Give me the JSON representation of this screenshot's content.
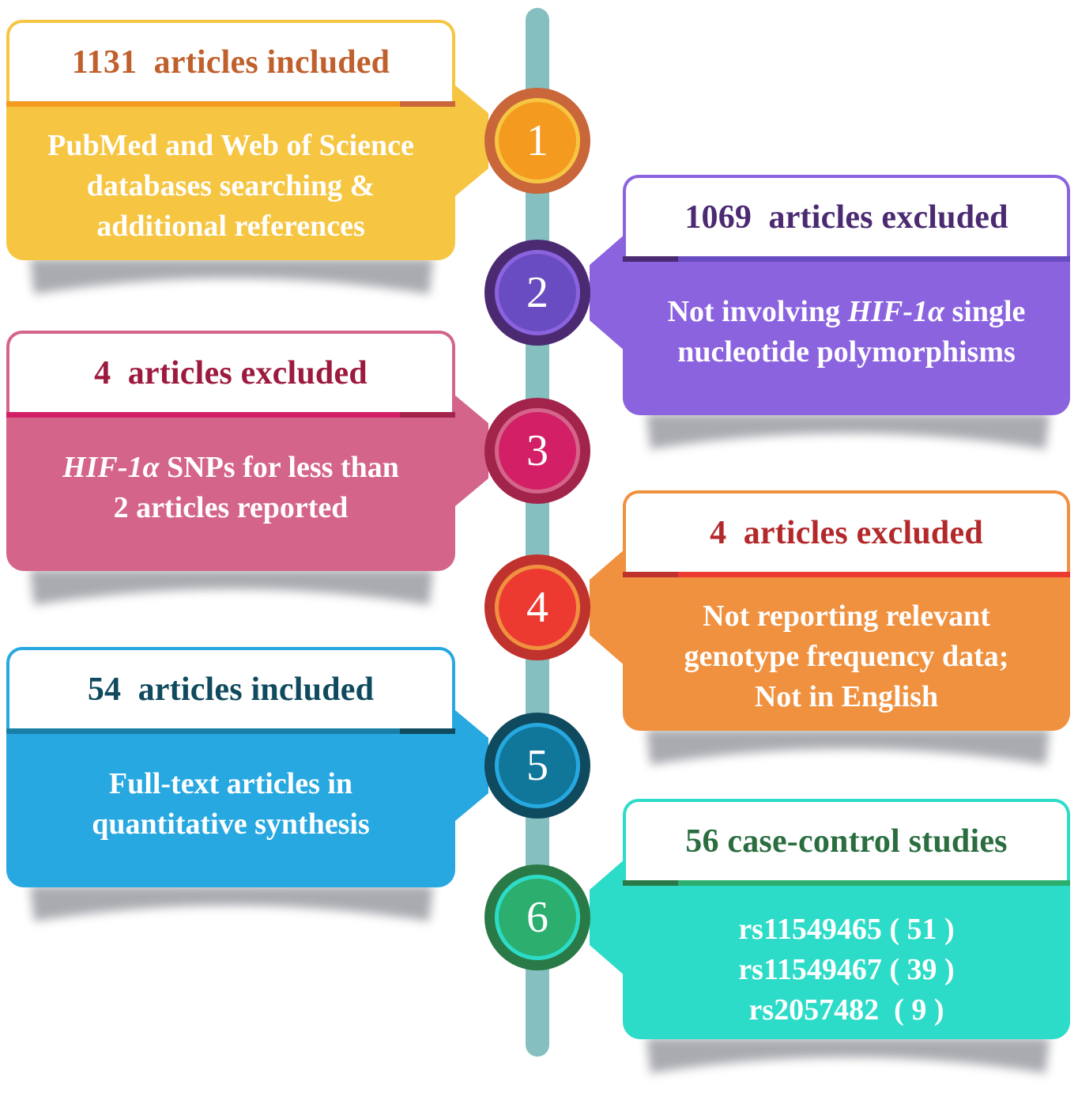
{
  "steps": [
    {
      "number": "1",
      "side": "left",
      "header": "1131  articles included",
      "body_lines": [
        [
          {
            "text": "PubMed and Web of Science"
          }
        ],
        [
          {
            "text": "databases searching &"
          }
        ],
        [
          {
            "text": "additional references"
          }
        ]
      ],
      "colors": {
        "header_text": "#c0602c",
        "border": "#f6c643",
        "divider": "#f49a1e",
        "divider_accent": "#c9663a",
        "body": "#f6c643",
        "circle_outer": "#c9663a",
        "circle_ring": "#f6c643",
        "circle_fill": "#f49a1e"
      }
    },
    {
      "number": "2",
      "side": "right",
      "header": "1069  articles excluded",
      "body_lines": [
        [
          {
            "text": "Not involving "
          },
          {
            "text": "HIF-1α",
            "italic": true
          },
          {
            "text": " single"
          }
        ],
        [
          {
            "text": "nucleotide polymorphisms"
          }
        ]
      ],
      "colors": {
        "header_text": "#4b2a72",
        "border": "#8b63df",
        "divider": "#6a4cc2",
        "divider_accent": "#4b2a72",
        "body": "#8b63df",
        "circle_outer": "#4b2a72",
        "circle_ring": "#8b63df",
        "circle_fill": "#6a4cc2"
      }
    },
    {
      "number": "3",
      "side": "left",
      "header": "4  articles excluded",
      "body_lines": [
        [
          {
            "text": "HIF-1α",
            "italic": true
          },
          {
            "text": " SNPs for less than"
          }
        ],
        [
          {
            "text": "2 articles reported"
          }
        ]
      ],
      "colors": {
        "header_text": "#9c1a3d",
        "border": "#d4648a",
        "divider": "#d21f66",
        "divider_accent": "#a3244b",
        "body": "#d4648a",
        "circle_outer": "#a3244b",
        "circle_ring": "#d4648a",
        "circle_fill": "#d21f66"
      }
    },
    {
      "number": "4",
      "side": "right",
      "header": "4  articles excluded",
      "body_lines": [
        [
          {
            "text": "Not reporting relevant"
          }
        ],
        [
          {
            "text": "genotype frequency data;"
          }
        ],
        [
          {
            "text": "Not in English"
          }
        ]
      ],
      "colors": {
        "header_text": "#b3292b",
        "border": "#f0913f",
        "divider": "#ec3a30",
        "divider_accent": "#c0322e",
        "body": "#f0913f",
        "circle_outer": "#c0322e",
        "circle_ring": "#f0913f",
        "circle_fill": "#ec3a30"
      }
    },
    {
      "number": "5",
      "side": "left",
      "header": "54  articles included",
      "body_lines": [
        [
          {
            "text": "Full-text articles in"
          }
        ],
        [
          {
            "text": "quantitative synthesis"
          }
        ]
      ],
      "colors": {
        "header_text": "#0f4a5e",
        "border": "#27a8e0",
        "divider": "#1a7fa6",
        "divider_accent": "#0f4a5e",
        "body": "#27a8e0",
        "circle_outer": "#0f4a5e",
        "circle_ring": "#27a8e0",
        "circle_fill": "#10779a"
      }
    },
    {
      "number": "6",
      "side": "right",
      "header": "56 case-control studies",
      "body_lines": [
        [
          {
            "text": "rs11549465 ( 51 )"
          }
        ],
        [
          {
            "text": "rs11549467 ( 39 )"
          }
        ],
        [
          {
            "text": "rs2057482  ( 9 )"
          }
        ]
      ],
      "colors": {
        "header_text": "#2a6e3f",
        "border": "#2ddcc8",
        "divider": "#2bae6e",
        "divider_accent": "#2a7a47",
        "body": "#2ddcc8",
        "circle_outer": "#2a7a47",
        "circle_ring": "#2ddcc8",
        "circle_fill": "#2bae6e"
      }
    }
  ],
  "rail_color": "#86bfc0"
}
